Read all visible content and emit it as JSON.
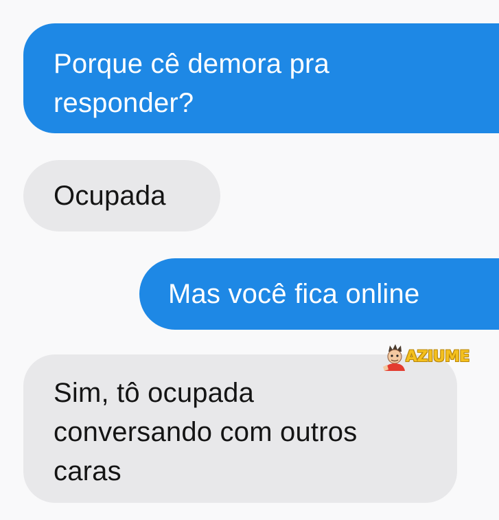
{
  "conversation": {
    "messages": [
      {
        "sender": "me",
        "text": "Porque cê demora pra\nresponder?"
      },
      {
        "sender": "them",
        "text": "Ocupada"
      },
      {
        "sender": "me",
        "text": "Mas você fica online"
      },
      {
        "sender": "them",
        "text": "Sim, tô ocupada\nconversando com outros\ncaras"
      }
    ]
  },
  "watermark": {
    "text": "AZIUME",
    "color": "#f4c01e"
  },
  "colors": {
    "sent_bubble": "#1e88e5",
    "received_bubble": "#e8e8ea",
    "background": "#f9f9fa"
  }
}
